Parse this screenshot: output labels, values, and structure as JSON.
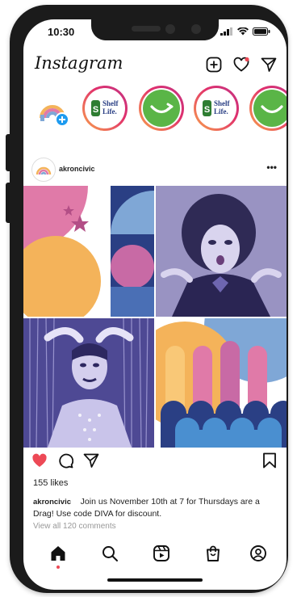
{
  "status_bar": {
    "time": "10:30"
  },
  "header": {
    "logo": "Instagram"
  },
  "stories": [
    {
      "type": "own"
    },
    {
      "type": "shelf-life",
      "line1": "Shelf",
      "line2": "Life."
    },
    {
      "type": "green-mark"
    },
    {
      "type": "shelf-life",
      "line1": "Shelf",
      "line2": "Life."
    },
    {
      "type": "green-mark"
    }
  ],
  "post": {
    "username": "akroncivic",
    "more": "•••",
    "likes": "155 likes",
    "caption_user": "akroncivic",
    "caption_text": "Join us November 10th at 7 for Thursdays are a Drag! Use code DIVA for discount.",
    "comments": "View all 120 comments"
  },
  "colors": {
    "like_red": "#ed4956",
    "accent_pink": "#e07aa8",
    "accent_orange": "#f4b35a",
    "accent_navy": "#2a3f84",
    "accent_blue": "#7fa7d6",
    "photo_tint": "#6b5fa8"
  }
}
